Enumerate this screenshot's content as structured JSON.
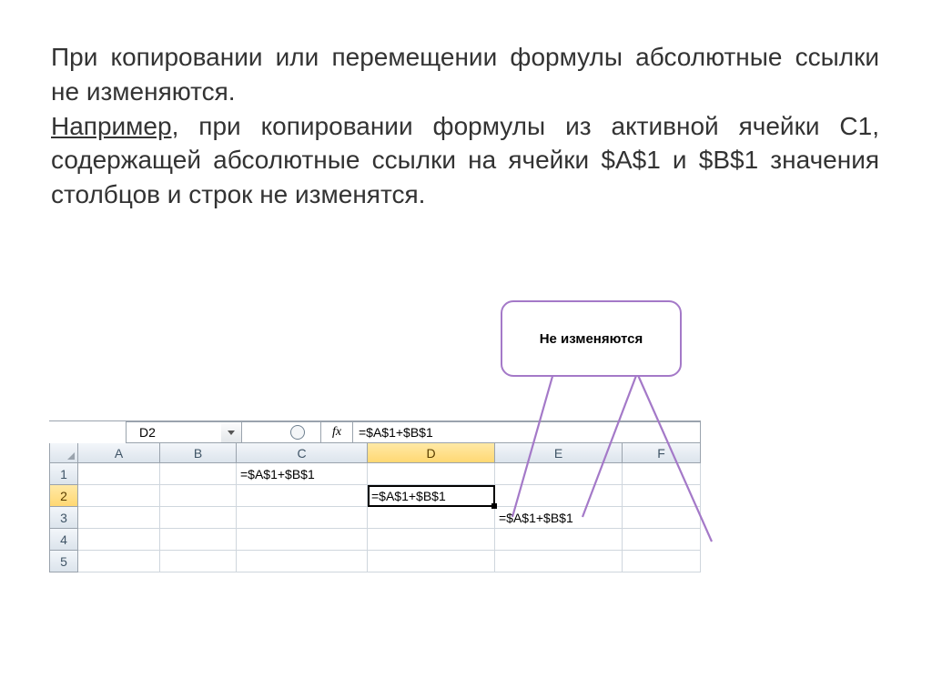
{
  "text": {
    "p1_a": "При копировании или перемещении формулы абсолютные ссылки не  изменяются.",
    "p2_lead": " Например,",
    "p2_rest": " при  копировании формулы из активной ячейки С1, содержащей абсолютные ссылки на ячейки $A$1  и $B$1 значения столбцов и строк не изменятся."
  },
  "callout": {
    "label": "Не изменяются"
  },
  "excel": {
    "name_box": "D2",
    "fx_label": "fx",
    "formula_bar": "=$A$1+$B$1",
    "columns": [
      "A",
      "B",
      "C",
      "D",
      "E",
      "F"
    ],
    "rows": [
      "1",
      "2",
      "3",
      "4",
      "5"
    ],
    "active_col_index": 3,
    "active_row_index": 1,
    "cells": {
      "C1": "=$A$1+$B$1",
      "D2": "=$A$1+$B$1",
      "E3": "=$A$1+$B$1"
    }
  }
}
